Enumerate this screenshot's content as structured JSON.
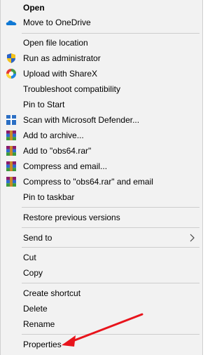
{
  "menu": {
    "items": [
      {
        "id": "open",
        "label": "Open",
        "bold": true
      },
      {
        "id": "onedrive",
        "label": "Move to OneDrive",
        "icon": "onedrive-cloud-icon"
      },
      {
        "id": "open-file-location",
        "label": "Open file location"
      },
      {
        "id": "run-admin",
        "label": "Run as administrator",
        "icon": "uac-shield-icon"
      },
      {
        "id": "sharex",
        "label": "Upload with ShareX",
        "icon": "sharex-icon"
      },
      {
        "id": "troubleshoot",
        "label": "Troubleshoot compatibility"
      },
      {
        "id": "pin-start",
        "label": "Pin to Start"
      },
      {
        "id": "defender",
        "label": "Scan with Microsoft Defender...",
        "icon": "defender-shield-icon"
      },
      {
        "id": "add-archive",
        "label": "Add to archive...",
        "icon": "winrar-icon"
      },
      {
        "id": "add-rar",
        "label": "Add to \"obs64.rar\"",
        "icon": "winrar-icon"
      },
      {
        "id": "compress-email",
        "label": "Compress and email...",
        "icon": "winrar-icon"
      },
      {
        "id": "compress-rar-email",
        "label": "Compress to \"obs64.rar\" and email",
        "icon": "winrar-icon"
      },
      {
        "id": "pin-taskbar",
        "label": "Pin to taskbar"
      },
      {
        "id": "restore",
        "label": "Restore previous versions"
      },
      {
        "id": "send-to",
        "label": "Send to",
        "submenu": true
      },
      {
        "id": "cut",
        "label": "Cut"
      },
      {
        "id": "copy",
        "label": "Copy"
      },
      {
        "id": "create-shortcut",
        "label": "Create shortcut"
      },
      {
        "id": "delete",
        "label": "Delete"
      },
      {
        "id": "rename",
        "label": "Rename"
      },
      {
        "id": "properties",
        "label": "Properties"
      }
    ]
  },
  "colors": {
    "menu_background": "#f2f2f2",
    "separator": "#cdcdcd",
    "annotation_arrow": "#e8141c"
  }
}
